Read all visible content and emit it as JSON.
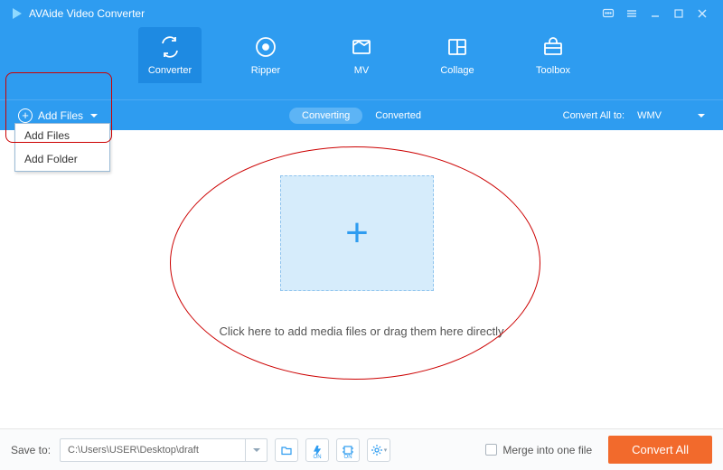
{
  "app": {
    "title": "AVAide Video Converter"
  },
  "nav": {
    "items": [
      {
        "label": "Converter"
      },
      {
        "label": "Ripper"
      },
      {
        "label": "MV"
      },
      {
        "label": "Collage"
      },
      {
        "label": "Toolbox"
      }
    ]
  },
  "subbar": {
    "add_files": "Add Files",
    "tab_converting": "Converting",
    "tab_converted": "Converted",
    "convert_all_label": "Convert All to:",
    "convert_all_value": "WMV"
  },
  "dropdown": {
    "item_add_files": "Add Files",
    "item_add_folder": "Add Folder"
  },
  "main": {
    "hint": "Click here to add media files or drag them here directly"
  },
  "bottom": {
    "save_label": "Save to:",
    "save_path": "C:\\Users\\USER\\Desktop\\draft",
    "merge_label": "Merge into one file",
    "convert_button": "Convert All"
  }
}
